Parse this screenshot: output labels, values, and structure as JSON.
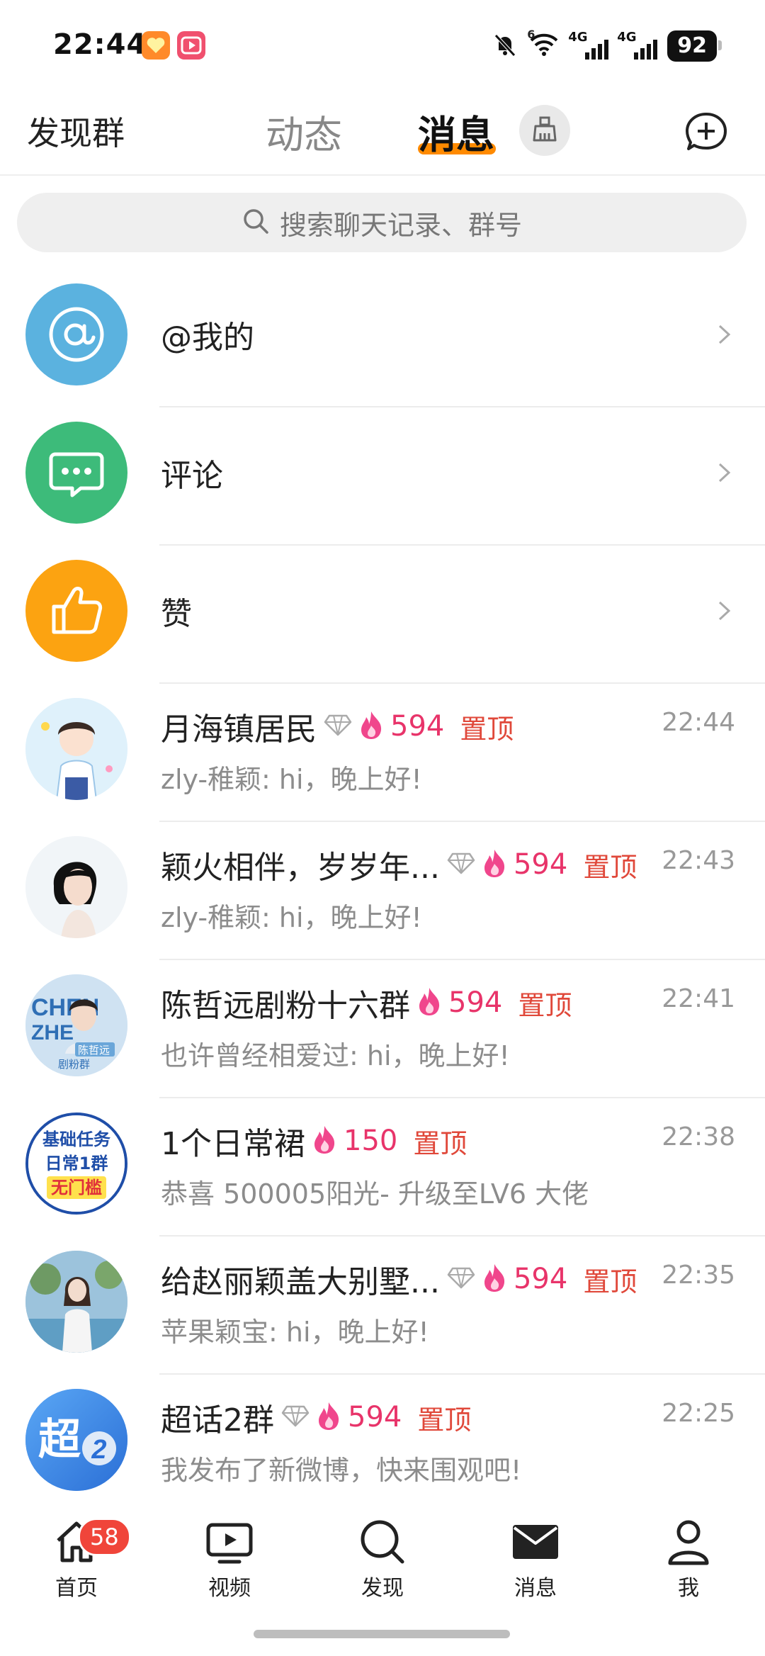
{
  "status_bar": {
    "time": "22:44",
    "signal1_label": "4G",
    "signal2_label": "4G",
    "wifi_label": "6",
    "battery": "92"
  },
  "header": {
    "left_link": "发现群",
    "tabs": [
      {
        "label": "动态",
        "active": false
      },
      {
        "label": "消息",
        "active": true
      }
    ],
    "icons": [
      "broom-icon",
      "compose-plus-icon"
    ]
  },
  "search": {
    "placeholder": "搜索聊天记录、群号"
  },
  "system_items": [
    {
      "label": "@我的",
      "icon": "at-icon",
      "color": "#5bb2df"
    },
    {
      "label": "评论",
      "icon": "comment-icon",
      "color": "#3dbb7a"
    },
    {
      "label": "赞",
      "icon": "thumbs-up-icon",
      "color": "#fca311"
    }
  ],
  "chats": [
    {
      "name": "月海镇居民",
      "diamond": true,
      "fire": "594",
      "pinned": "置顶",
      "time": "22:44",
      "preview": "zly-稚颖: hi，晚上好!"
    },
    {
      "name": "颖火相伴，岁岁年...",
      "diamond": true,
      "fire": "594",
      "pinned": "置顶",
      "time": "22:43",
      "preview": "zly-稚颖: hi，晚上好!"
    },
    {
      "name": "陈哲远剧粉十六群",
      "diamond": false,
      "fire": "594",
      "pinned": "置顶",
      "time": "22:41",
      "preview": "也许曾经相爱过: hi，晚上好!"
    },
    {
      "name": "1个日常裙",
      "diamond": false,
      "fire": "150",
      "pinned": "置顶",
      "time": "22:38",
      "preview": "恭喜 500005阳光- 升级至LV6 大佬"
    },
    {
      "name": "给赵丽颖盖大别墅...",
      "diamond": true,
      "fire": "594",
      "pinned": "置顶",
      "time": "22:35",
      "preview": "苹果颖宝: hi，晚上好!"
    },
    {
      "name": "超话2群",
      "diamond": true,
      "fire": "594",
      "pinned": "置顶",
      "time": "22:25",
      "preview": "我发布了新微博，快来围观吧!"
    }
  ],
  "avatar_texts": {
    "chenzheyuan": [
      "CHEN",
      "ZHE",
      "陈哲远",
      "剧粉群"
    ],
    "daily": [
      "基础任务",
      "日常1群",
      "无门槛"
    ],
    "chaohua": [
      "超",
      "2"
    ]
  },
  "bottom_nav": {
    "items": [
      {
        "label": "首页",
        "icon": "home-icon"
      },
      {
        "label": "视频",
        "icon": "video-icon"
      },
      {
        "label": "发现",
        "icon": "search-icon"
      },
      {
        "label": "消息",
        "icon": "mail-icon"
      },
      {
        "label": "我",
        "icon": "profile-icon"
      }
    ],
    "home_badge": "58"
  }
}
